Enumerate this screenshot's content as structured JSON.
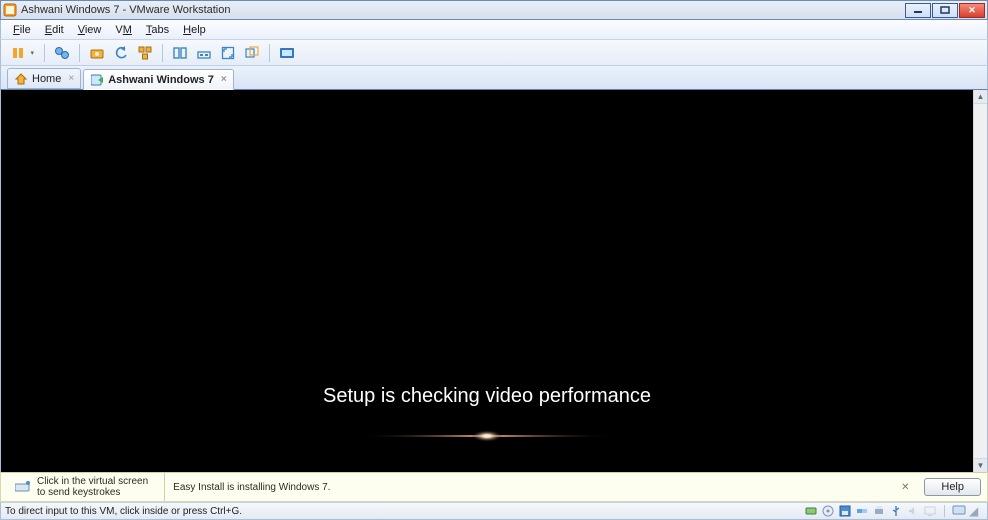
{
  "window": {
    "title": "Ashwani Windows 7 - VMware Workstation"
  },
  "menu": {
    "items": [
      {
        "label": "File",
        "mnemonic": "F"
      },
      {
        "label": "Edit",
        "mnemonic": "E"
      },
      {
        "label": "View",
        "mnemonic": "V"
      },
      {
        "label": "VM",
        "mnemonic": "M"
      },
      {
        "label": "Tabs",
        "mnemonic": "T"
      },
      {
        "label": "Help",
        "mnemonic": "H"
      }
    ]
  },
  "toolbar": {
    "icons": {
      "pause": "pause-icon",
      "snapshot": "snapshot-icon",
      "snapshot_revert": "revert-icon",
      "snapshot_manager": "snapshot-manager-icon",
      "show_library": "library-icon",
      "show_thumbnail": "thumbnail-icon",
      "fullscreen": "fullscreen-icon",
      "unity": "unity-icon",
      "console": "console-icon"
    }
  },
  "tabs": [
    {
      "label": "Home",
      "icon": "home-icon",
      "closeable": true,
      "active": false
    },
    {
      "label": "Ashwani Windows 7",
      "icon": "vm-play-icon",
      "closeable": true,
      "active": true
    }
  ],
  "vm_screen": {
    "message": "Setup is checking video performance"
  },
  "hint": {
    "keystrokes_line1": "Click in the virtual screen",
    "keystrokes_line2": "to send keystrokes",
    "easy_install": "Easy Install is installing Windows 7.",
    "help_label": "Help"
  },
  "status": {
    "text": "To direct input to this VM, click inside or press Ctrl+G.",
    "tray_icons": [
      "hdd-icon",
      "cd-icon",
      "floppy-icon",
      "net-icon",
      "printer-icon",
      "usb-icon",
      "sound-icon",
      "display-icon"
    ]
  },
  "colors": {
    "titlebar_border": "#6a8bb8",
    "panel_border": "#a9bfd6",
    "hint_bg": "#fdfef0"
  }
}
